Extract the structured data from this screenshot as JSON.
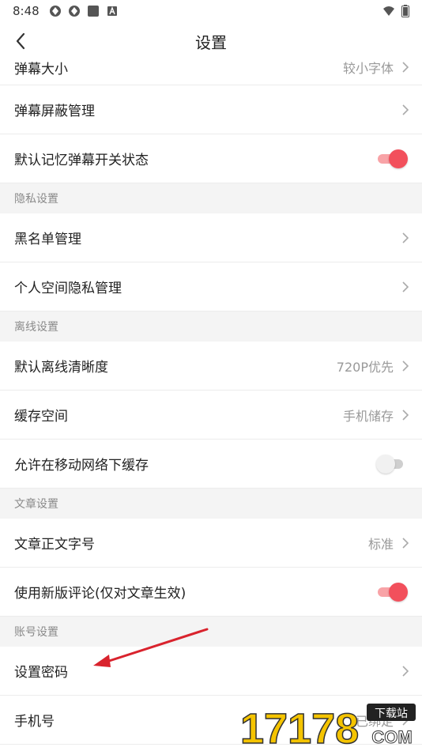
{
  "status_bar": {
    "time": "8:48"
  },
  "header": {
    "title": "设置"
  },
  "rows": {
    "danmu_size": {
      "label": "弹幕大小",
      "value": "较小字体"
    },
    "danmu_block": {
      "label": "弹幕屏蔽管理"
    },
    "danmu_remember": {
      "label": "默认记忆弹幕开关状态",
      "toggle": true
    },
    "privacy_section": "隐私设置",
    "blacklist": {
      "label": "黑名单管理"
    },
    "space_privacy": {
      "label": "个人空间隐私管理"
    },
    "offline_section": "离线设置",
    "offline_quality": {
      "label": "默认离线清晰度",
      "value": "720P优先"
    },
    "cache_space": {
      "label": "缓存空间",
      "value": "手机储存"
    },
    "mobile_cache": {
      "label": "允许在移动网络下缓存",
      "toggle": false
    },
    "article_section": "文章设置",
    "article_font": {
      "label": "文章正文字号",
      "value": "标准"
    },
    "new_comments": {
      "label": "使用新版评论(仅对文章生效)",
      "toggle": true
    },
    "account_section": "账号设置",
    "set_password": {
      "label": "设置密码"
    },
    "phone": {
      "label": "手机号",
      "value": "已绑定"
    }
  },
  "watermark": {
    "text": "17178",
    "badge": "下载站",
    "domain": "COM"
  },
  "colors": {
    "accent": "#f2505c",
    "accent_track": "#f8a3a7",
    "section_bg": "#f4f4f4",
    "arrow": "#d9232d"
  },
  "icons": [
    "back-arrow-icon",
    "chevron-right-icon",
    "wifi-icon",
    "battery-icon"
  ]
}
